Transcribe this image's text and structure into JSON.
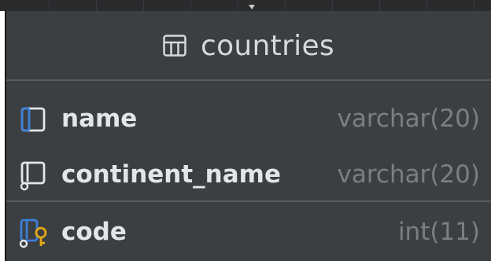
{
  "table": {
    "title": "countries",
    "header_icon": "table-grid-icon",
    "columns": [
      {
        "name": "name",
        "type": "varchar(20)",
        "icon": "column-icon"
      },
      {
        "name": "continent_name",
        "type": "varchar(20)",
        "icon": "nullable-column-icon"
      },
      {
        "name": "code",
        "type": "int(11)",
        "icon": "primary-key-column-icon"
      }
    ]
  },
  "colors": {
    "card_background": "#3c3f41",
    "header_text": "#d7d8da",
    "column_text": "#e4e5e7",
    "type_text": "#7c7f82",
    "column_icon_accent": "#3d7fd9",
    "key_icon": "#e3a81a"
  }
}
